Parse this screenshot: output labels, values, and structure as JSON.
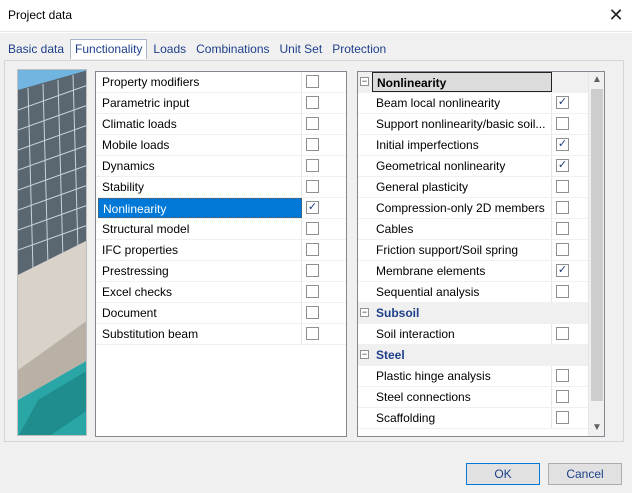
{
  "window": {
    "title": "Project data",
    "close_label": "✕"
  },
  "tabs": [
    {
      "label": "Basic data",
      "active": false
    },
    {
      "label": "Functionality",
      "active": true
    },
    {
      "label": "Loads",
      "active": false
    },
    {
      "label": "Combinations",
      "active": false
    },
    {
      "label": "Unit Set",
      "active": false
    },
    {
      "label": "Protection",
      "active": false
    }
  ],
  "functionality_list": [
    {
      "label": "Property modifiers",
      "checked": false,
      "selected": false
    },
    {
      "label": "Parametric input",
      "checked": false,
      "selected": false
    },
    {
      "label": "Climatic loads",
      "checked": false,
      "selected": false
    },
    {
      "label": "Mobile loads",
      "checked": false,
      "selected": false
    },
    {
      "label": "Dynamics",
      "checked": false,
      "selected": false
    },
    {
      "label": "Stability",
      "checked": false,
      "selected": false
    },
    {
      "label": "Nonlinearity",
      "checked": true,
      "selected": true
    },
    {
      "label": "Structural model",
      "checked": false,
      "selected": false
    },
    {
      "label": "IFC properties",
      "checked": false,
      "selected": false
    },
    {
      "label": "Prestressing",
      "checked": false,
      "selected": false
    },
    {
      "label": "Excel checks",
      "checked": false,
      "selected": false
    },
    {
      "label": "Document",
      "checked": false,
      "selected": false
    },
    {
      "label": "Substitution beam",
      "checked": false,
      "selected": false
    }
  ],
  "detail_tree": [
    {
      "type": "group",
      "label": "Nonlinearity",
      "expander": "−"
    },
    {
      "type": "item",
      "label": "Beam local nonlinearity",
      "checked": true
    },
    {
      "type": "item",
      "label": "Support nonlinearity/basic soil...",
      "checked": false
    },
    {
      "type": "item",
      "label": "Initial imperfections",
      "checked": true
    },
    {
      "type": "item",
      "label": "Geometrical nonlinearity",
      "checked": true
    },
    {
      "type": "item",
      "label": "General plasticity",
      "checked": false
    },
    {
      "type": "item",
      "label": "Compression-only 2D members",
      "checked": false
    },
    {
      "type": "item",
      "label": "Cables",
      "checked": false
    },
    {
      "type": "item",
      "label": "Friction support/Soil spring",
      "checked": false
    },
    {
      "type": "item",
      "label": "Membrane elements",
      "checked": true
    },
    {
      "type": "item",
      "label": "Sequential analysis",
      "checked": false
    },
    {
      "type": "group",
      "label": "Subsoil",
      "expander": "−"
    },
    {
      "type": "item",
      "label": "Soil interaction",
      "checked": false
    },
    {
      "type": "group",
      "label": "Steel",
      "expander": "−"
    },
    {
      "type": "item",
      "label": "Plastic hinge analysis",
      "checked": false
    },
    {
      "type": "item",
      "label": "Steel connections",
      "checked": false
    },
    {
      "type": "item",
      "label": "Scaffolding",
      "checked": false
    }
  ],
  "scrollbar": {
    "up_glyph": "▲",
    "down_glyph": "▼"
  },
  "buttons": {
    "ok_label": "OK",
    "cancel_label": "Cancel"
  },
  "icons": {
    "close": "close-icon",
    "check": "check-icon",
    "collapse": "collapse-icon"
  },
  "colors": {
    "selection": "#0078d7",
    "link_text": "#1d3f8a",
    "dialog_bg": "#f0f0f0"
  }
}
